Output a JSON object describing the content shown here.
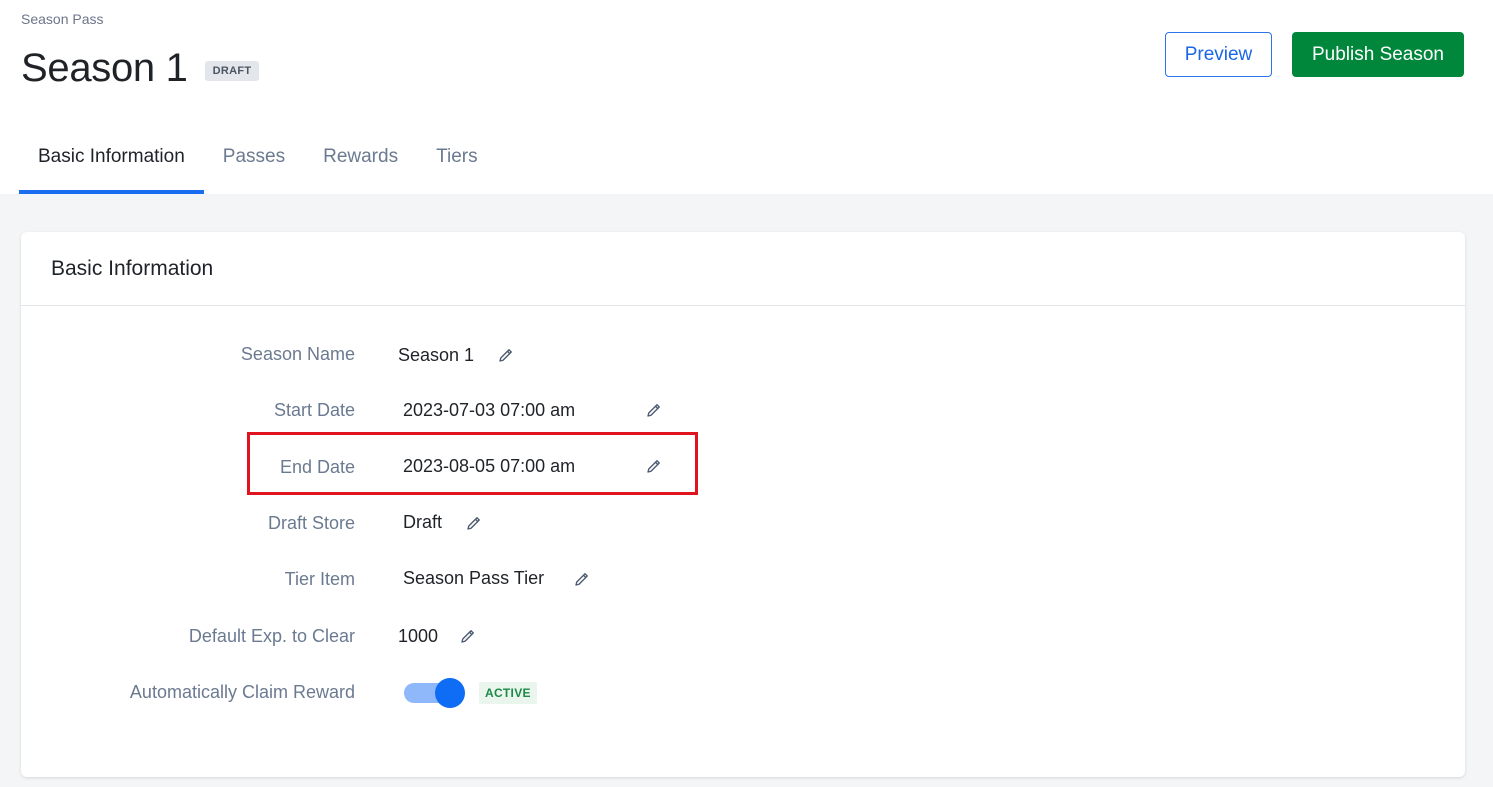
{
  "header": {
    "breadcrumb": "Season Pass",
    "title": "Season 1",
    "status_badge": "DRAFT",
    "preview_label": "Preview",
    "publish_label": "Publish Season"
  },
  "tabs": [
    {
      "label": "Basic Information",
      "active": true
    },
    {
      "label": "Passes",
      "active": false
    },
    {
      "label": "Rewards",
      "active": false
    },
    {
      "label": "Tiers",
      "active": false
    }
  ],
  "card": {
    "title": "Basic Information",
    "fields": [
      {
        "label": "Season Name",
        "value": "Season 1",
        "icon": "pencil-icon"
      },
      {
        "label": "Start Date",
        "value": "2023-07-03 07:00 am",
        "icon": "pencil-icon"
      },
      {
        "label": "End Date",
        "value": "2023-08-05 07:00 am",
        "icon": "pencil-icon",
        "highlighted": true
      },
      {
        "label": "Draft Store",
        "value": "Draft",
        "icon": "pencil-icon"
      },
      {
        "label": "Tier Item",
        "value": "Season Pass Tier",
        "icon": "pencil-icon"
      },
      {
        "label": "Default Exp. to Clear",
        "value": "1000",
        "icon": "pencil-icon"
      }
    ],
    "auto_claim": {
      "label": "Automatically Claim Reward",
      "enabled": true,
      "status_badge": "ACTIVE"
    }
  },
  "colors": {
    "accent": "#1a6cf0",
    "publish": "#00873c",
    "highlight": "#e0141e",
    "active_badge": "#1c8a45"
  }
}
